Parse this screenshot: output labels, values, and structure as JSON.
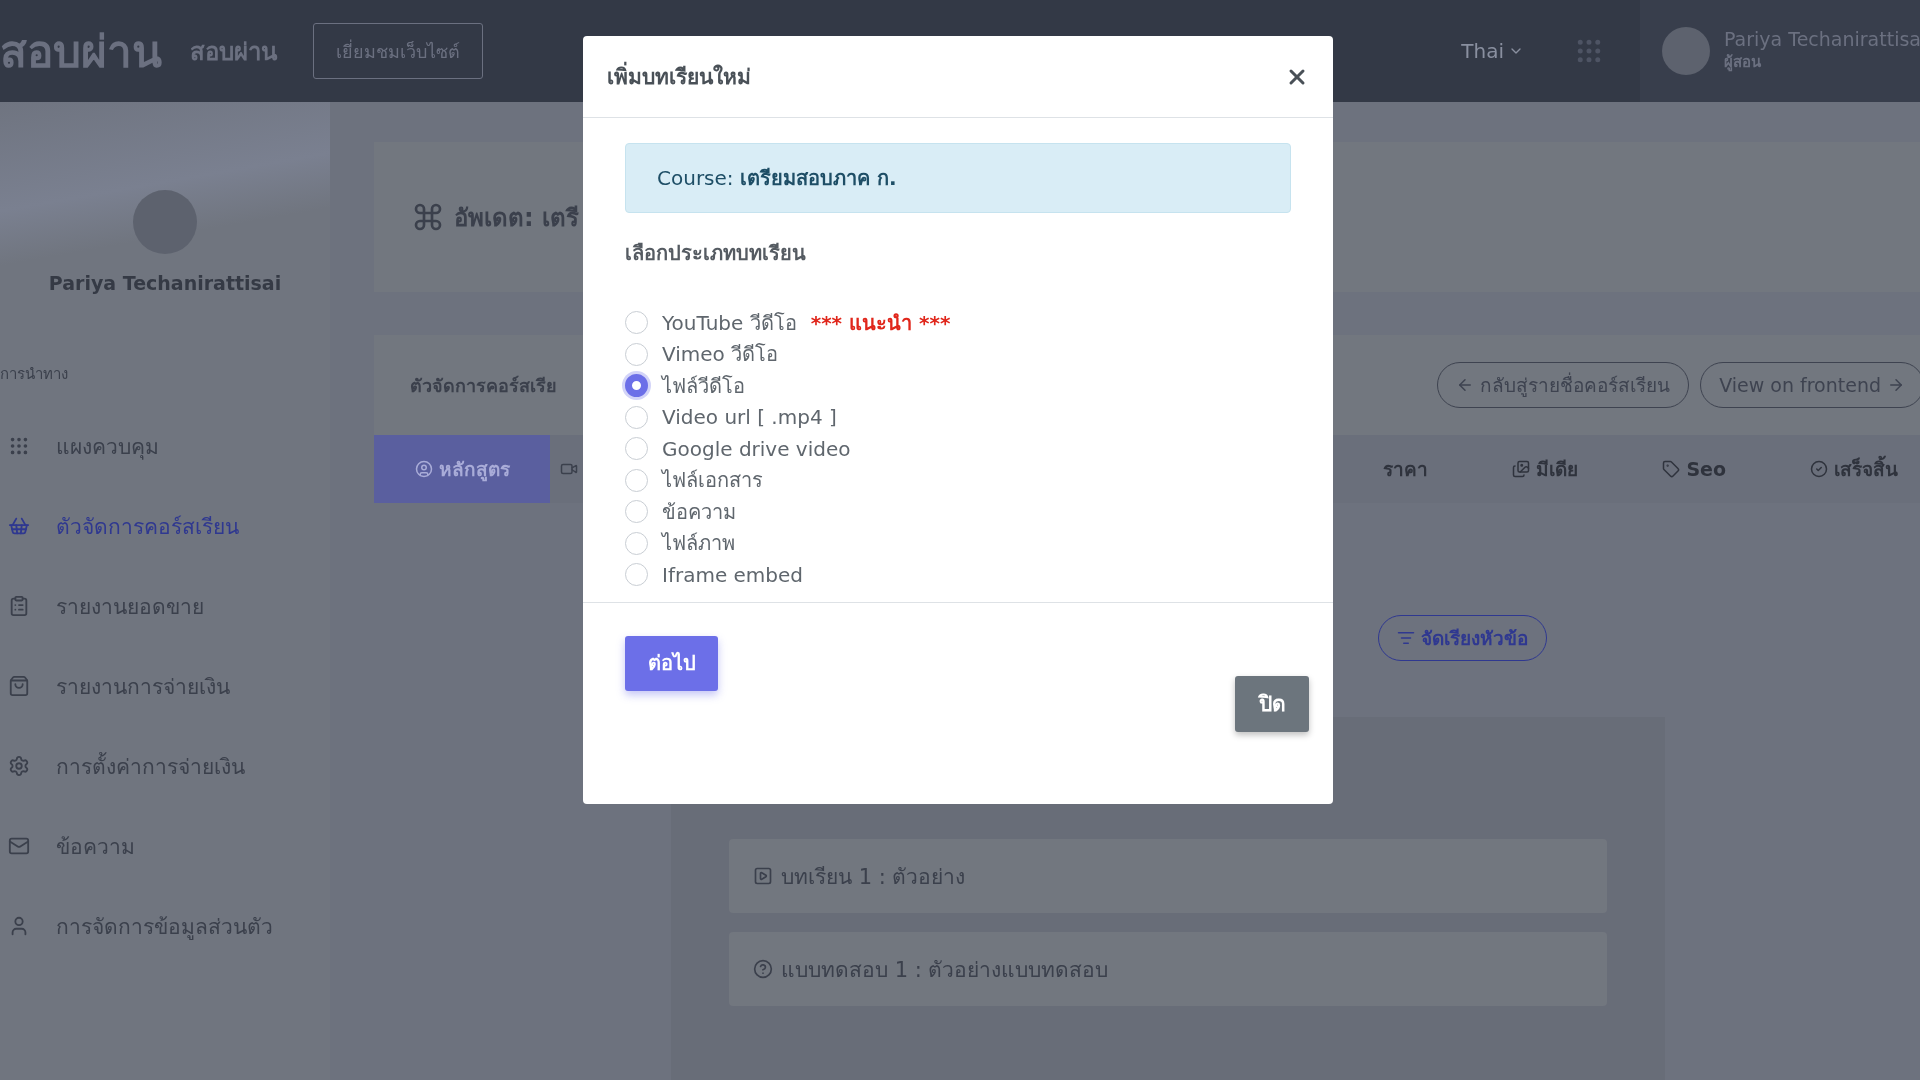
{
  "header": {
    "logo": "สอบผ่าน",
    "site_name": "สอบผ่าน",
    "visit_button": "เยี่ยมชมเว็บไซต์",
    "language": "Thai",
    "user": {
      "name": "Pariya Techanirattisa",
      "role": "ผู้สอน"
    }
  },
  "sidebar": {
    "profile_name": "Pariya Techanirattisai",
    "nav_heading": "การนำทาง",
    "items": [
      {
        "label": "แผงควบคุม",
        "selected": false
      },
      {
        "label": "ตัวจัดการคอร์สเรียน",
        "selected": true
      },
      {
        "label": "รายงานยอดขาย",
        "selected": false
      },
      {
        "label": "รายงานการจ่ายเงิน",
        "selected": false
      },
      {
        "label": "การตั้งค่าการจ่ายเงิน",
        "selected": false
      },
      {
        "label": "ข้อความ",
        "selected": false
      },
      {
        "label": "การจัดการข้อมูลส่วนตัว",
        "selected": false
      }
    ]
  },
  "main": {
    "page_title": "อัพเดต: เตรี",
    "manager_title": "ตัวจัดการคอร์สเรีย",
    "back_button": "กลับสู่รายชื่อคอร์สเรียน",
    "frontend_button": "View on frontend",
    "tabs": [
      {
        "label": "หลักสูตร",
        "selected": true
      },
      {
        "label": "ราคา",
        "selected": false
      },
      {
        "label": "มีเดีย",
        "selected": false
      },
      {
        "label": "Seo",
        "selected": false
      },
      {
        "label": "เสร็จสิ้น",
        "selected": false
      }
    ],
    "sort_button": "จัดเรียงหัวข้อ",
    "lessons": [
      {
        "kind": "lesson",
        "title": "บทเรียน 1 : ตัวอย่าง"
      },
      {
        "kind": "quiz",
        "title": "แบบทดสอบ 1 : ตัวอย่างแบบทดสอบ"
      }
    ]
  },
  "modal": {
    "title": "เพิ่มบทเรียนใหม่",
    "course_info": "Course: **เตรียมสอบภาค ก.**",
    "type_label": "เลือกประเภทบทเรียน",
    "options": [
      {
        "label": "YouTube วีดีโอ",
        "note": "*** แนะนำ ***",
        "selected": false
      },
      {
        "label": "Vimeo วีดีโอ",
        "selected": false
      },
      {
        "label": "ไฟล์วีดีโอ",
        "selected": true
      },
      {
        "label": "Video url [ .mp4 ]",
        "selected": false
      },
      {
        "label": "Google drive video",
        "selected": false
      },
      {
        "label": "ไฟล์เอกสาร",
        "selected": false
      },
      {
        "label": "ข้อความ",
        "selected": false
      },
      {
        "label": "ไฟล์ภาพ",
        "selected": false
      },
      {
        "label": "Iframe embed",
        "selected": false
      }
    ],
    "next_button": "ต่อไป",
    "close_button": "ปิด"
  }
}
